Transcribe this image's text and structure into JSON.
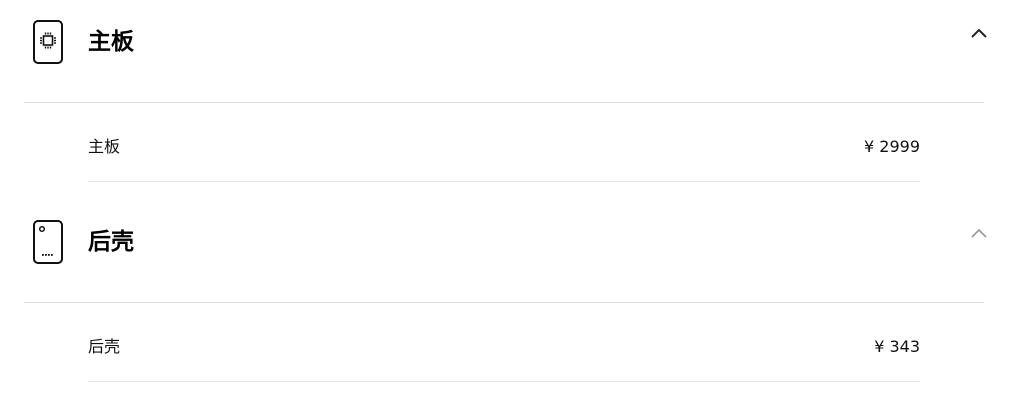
{
  "sections": [
    {
      "title": "主板",
      "icon": "motherboard-phone-icon",
      "expanded": true,
      "chevron_color": "#222222",
      "items": [
        {
          "label": "主板",
          "price": "¥ 2999"
        }
      ]
    },
    {
      "title": "后壳",
      "icon": "back-cover-phone-icon",
      "expanded": true,
      "chevron_color": "#999999",
      "items": [
        {
          "label": "后壳",
          "price": "¥ 343"
        }
      ]
    }
  ]
}
